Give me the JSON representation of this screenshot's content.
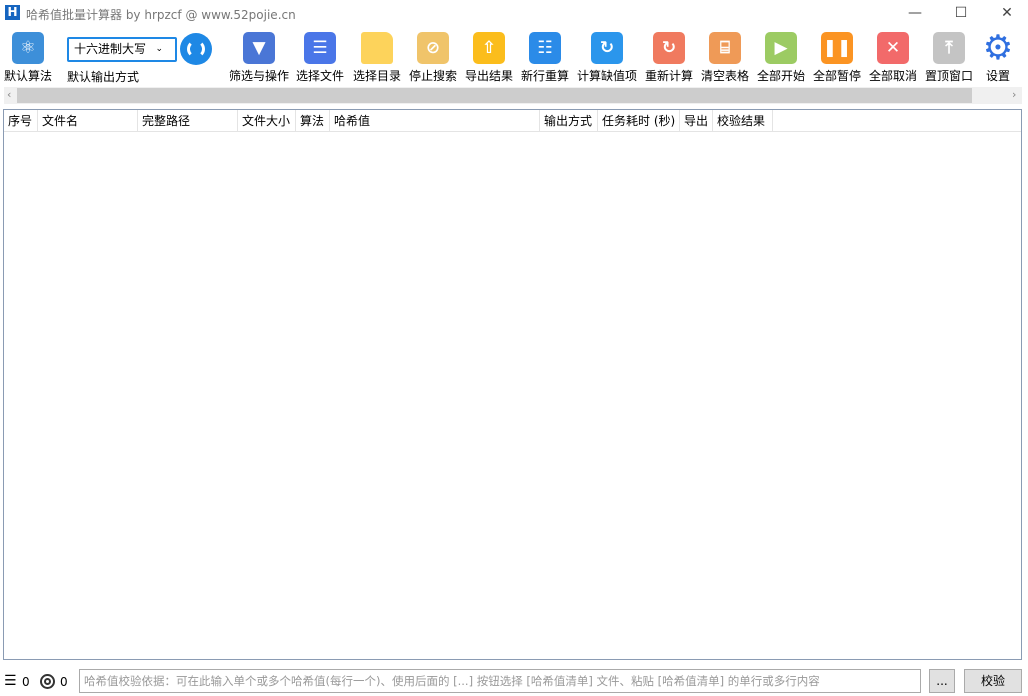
{
  "window": {
    "title": "哈希值批量计算器 by hrpzcf @ www.52pojie.cn",
    "logo": "H",
    "minimize": "—",
    "maximize": "☐",
    "close": "✕"
  },
  "toolbar": {
    "default_algo": {
      "label": "默认算法",
      "icon": "atom-icon",
      "color": "#3d8fd9"
    },
    "output_select": {
      "value": "十六进制大写",
      "label": "默认输出方式"
    },
    "refresh_icon": "refresh-icon",
    "buttons": [
      {
        "label": "筛选与操作",
        "icon": "filter-icon",
        "color": "#4a76d6",
        "glyph": "▼"
      },
      {
        "label": "选择文件",
        "icon": "file-icon",
        "color": "#4a76e8",
        "glyph": "☰"
      },
      {
        "label": "选择目录",
        "icon": "folder-icon",
        "color": "#fdd35b",
        "glyph": ""
      },
      {
        "label": "停止搜索",
        "icon": "stop-icon",
        "color": "#f0c46a",
        "glyph": "⊘"
      },
      {
        "label": "导出结果",
        "icon": "export-icon",
        "color": "#fbbd1c",
        "glyph": "⇧"
      },
      {
        "label": "新行重算",
        "icon": "document-icon",
        "color": "#2b8be8",
        "glyph": "☷"
      },
      {
        "label": "计算缺值项",
        "icon": "recalc-icon",
        "color": "#2b96ec",
        "glyph": "↻"
      },
      {
        "label": "重新计算",
        "icon": "redo-icon",
        "color": "#f07a5f",
        "glyph": "↻"
      },
      {
        "label": "清空表格",
        "icon": "basket-icon",
        "color": "#ef9a57",
        "glyph": "⌸"
      },
      {
        "label": "全部开始",
        "icon": "play-icon",
        "color": "#9ccb63",
        "glyph": "▶"
      },
      {
        "label": "全部暂停",
        "icon": "pause-icon",
        "color": "#fb9423",
        "glyph": "❚❚"
      },
      {
        "label": "全部取消",
        "icon": "cancel-icon",
        "color": "#f26a6a",
        "glyph": "✕"
      },
      {
        "label": "置顶窗口",
        "icon": "pin-top-icon",
        "color": "#c4c4c4",
        "glyph": "⤒"
      },
      {
        "label": "设置",
        "icon": "gear-icon",
        "color": "#2f6fe0",
        "glyph": "⚙"
      }
    ]
  },
  "table": {
    "columns": [
      {
        "label": "序号",
        "w": 34
      },
      {
        "label": "文件名",
        "w": 100
      },
      {
        "label": "完整路径",
        "w": 100
      },
      {
        "label": "文件大小",
        "w": 58
      },
      {
        "label": "算法",
        "w": 34
      },
      {
        "label": "哈希值",
        "w": 210
      },
      {
        "label": "输出方式",
        "w": 58
      },
      {
        "label": "任务耗时 (秒)",
        "w": 82
      },
      {
        "label": "导出",
        "w": 33
      },
      {
        "label": "校验结果",
        "w": 60
      }
    ],
    "rows": []
  },
  "status": {
    "total_count": "0",
    "checked_count": "0"
  },
  "verify": {
    "placeholder": "哈希值校验依据：可在此输入单个或多个哈希值(每行一个)、使用后面的 [...] 按钮选择 [哈希值清单] 文件、粘贴 [哈希值清单] 的单行或多行内容",
    "browse_label": "...",
    "verify_label": "校验"
  }
}
